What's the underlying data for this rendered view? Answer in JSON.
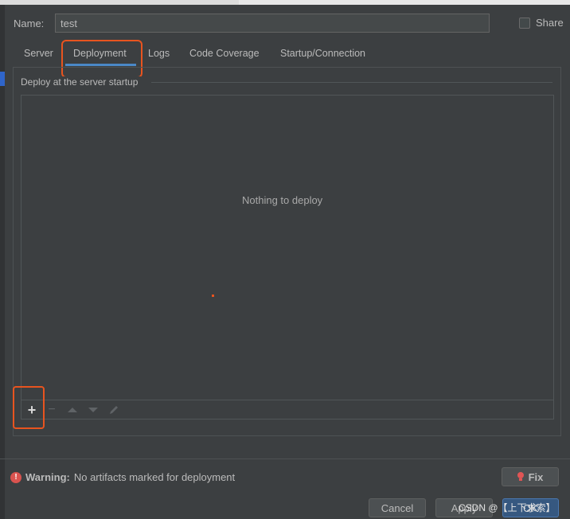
{
  "form": {
    "name_label": "Name:",
    "name_value": "test",
    "share_label": "Share",
    "share_checked": false
  },
  "tabs": [
    {
      "label": "Server"
    },
    {
      "label": "Deployment",
      "active": true
    },
    {
      "label": "Logs"
    },
    {
      "label": "Code Coverage"
    },
    {
      "label": "Startup/Connection"
    }
  ],
  "deployment": {
    "section_title": "Deploy at the server startup",
    "empty_text": "Nothing to deploy",
    "toolbar_icons": [
      "add-icon",
      "remove-icon",
      "move-up-icon",
      "move-down-icon",
      "edit-icon"
    ],
    "add_symbol": "+",
    "remove_symbol": "−"
  },
  "warning": {
    "icon_symbol": "!",
    "title": "Warning:",
    "message": "No artifacts marked for deployment"
  },
  "buttons": {
    "fix": "Fix",
    "cancel": "Cancel",
    "apply": "Apply",
    "ok": "OK"
  },
  "watermark": "CSDN @【上下求索】",
  "colors": {
    "background": "#3c3f41",
    "accent_blue": "#4a88c7",
    "highlight_red": "#e8541f",
    "error_red": "#d9534f"
  }
}
